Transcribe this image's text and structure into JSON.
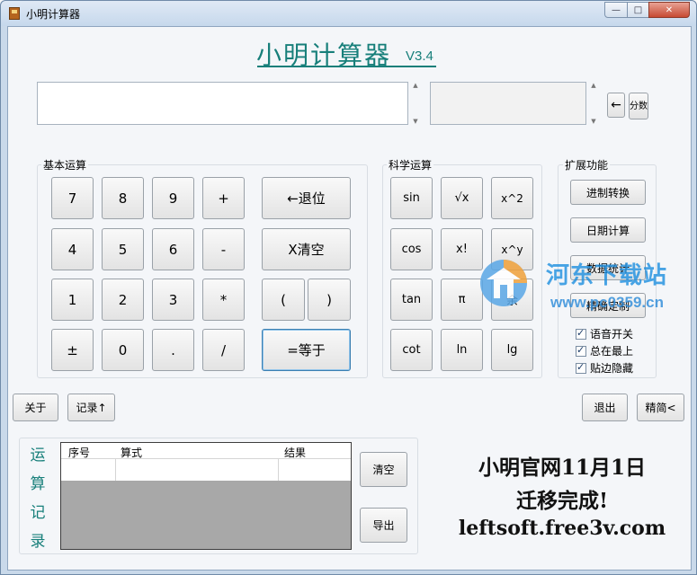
{
  "window": {
    "title": "小明计算器",
    "controls": {
      "minimize": "—",
      "maximize": "□",
      "close": "✕"
    }
  },
  "header": {
    "title": "小明计算器",
    "version": "V3.4"
  },
  "display": {
    "arrow_label": "←",
    "frac_label": "分数"
  },
  "basic": {
    "label": "基本运算",
    "keys": [
      "7",
      "8",
      "9",
      "+",
      "4",
      "5",
      "6",
      "-",
      "1",
      "2",
      "3",
      "*",
      "±",
      "0",
      ".",
      "/"
    ],
    "backspace": "←退位",
    "clear": "X清空",
    "lparen": "(",
    "rparen": ")",
    "equals": "=等于"
  },
  "science": {
    "label": "科学运算",
    "keys": [
      "sin",
      "√x",
      "x^2",
      "cos",
      "x!",
      "x^y",
      "tan",
      "π",
      "余",
      "cot",
      "ln",
      "lg"
    ]
  },
  "extended": {
    "label": "扩展功能",
    "buttons": [
      "进制转换",
      "日期计算",
      "数据统计",
      "精确定制"
    ],
    "checkboxes": [
      "语音开关",
      "总在最上",
      "贴边隐藏"
    ]
  },
  "bottom": {
    "about": "关于",
    "record": "记录↑",
    "exit": "退出",
    "simple": "精简<"
  },
  "records": {
    "side_title": [
      "运",
      "算",
      "记",
      "录"
    ],
    "columns": [
      "序号",
      "算式",
      "结果"
    ],
    "clear": "清空",
    "export": "导出"
  },
  "announcement": {
    "line1": "小明官网11月1日",
    "line2": "迁移完成!",
    "line3": "leftsoft.free3v.com"
  },
  "watermark": {
    "site": "河东下载站",
    "url": "www.pc0359.cn"
  },
  "colors": {
    "accent": "#177f7a",
    "watermark": "#1d8fe0"
  }
}
